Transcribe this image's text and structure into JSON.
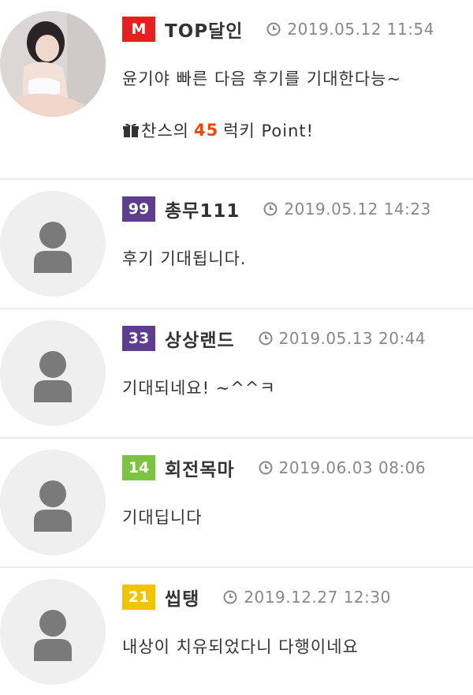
{
  "colors": {
    "level_red": "#e41f1f",
    "level_purple": "#5c3d8e",
    "level_green": "#7cc243",
    "level_yellow": "#f2c400",
    "point_orange": "#f0480a"
  },
  "icons": {
    "clock": "clock-icon",
    "gift": "gift-icon",
    "user": "user-silhouette-icon"
  },
  "comments": [
    {
      "level": "M",
      "nickname": "TOP달인",
      "date": "2019.05.12 11:54",
      "text": "윤기야 빠른 다음 후기를 기대한다능~",
      "lucky_prefix": "찬스의",
      "lucky_points": "45",
      "lucky_suffix": "럭키 Point!"
    },
    {
      "level": "99",
      "nickname": "총무111",
      "date": "2019.05.12 14:23",
      "text": "후기 기대됩니다."
    },
    {
      "level": "33",
      "nickname": "상상랜드",
      "date": "2019.05.13 20:44",
      "text": "기대되네요! ~^^ㅋ"
    },
    {
      "level": "14",
      "nickname": "회전목마",
      "date": "2019.06.03 08:06",
      "text": "기대딥니다"
    },
    {
      "level": "21",
      "nickname": "씹탱",
      "date": "2019.12.27 12:30",
      "text": "내상이 치유되었다니 다행이네요"
    }
  ]
}
